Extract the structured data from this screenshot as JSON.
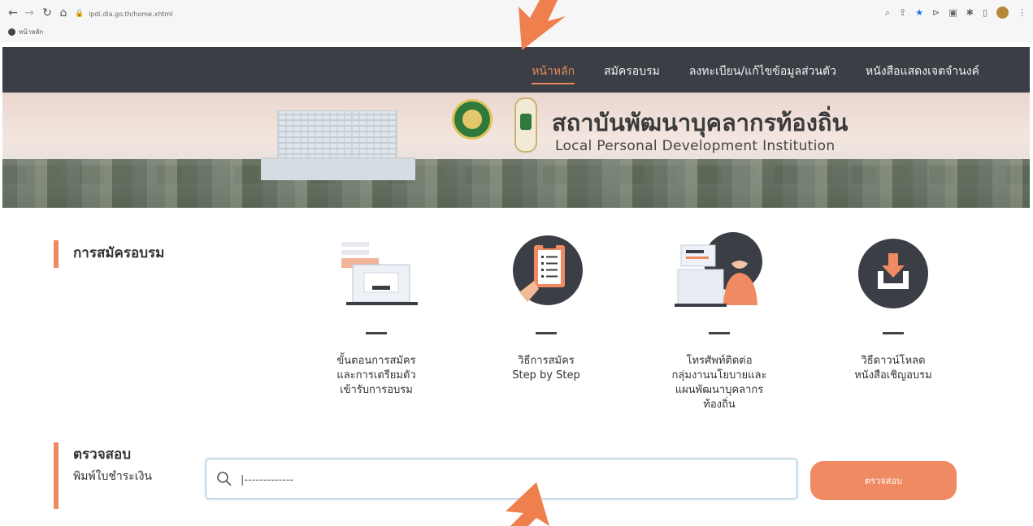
{
  "browser": {
    "url": "lpdi.dla.go.th/home.xhtml",
    "bookmark_label": "หน้าหลัก"
  },
  "nav": {
    "items": [
      {
        "label": "หน้าหลัก",
        "active": true
      },
      {
        "label": "สมัครอบรม",
        "active": false
      },
      {
        "label": "ลงทะเบียน/แก้ไขข้อมูลส่วนตัว",
        "active": false
      },
      {
        "label": "หนังสือแสดงเจตจำนงค์",
        "active": false
      }
    ]
  },
  "banner": {
    "org_name_th": "สถาบันพัฒนาบุคลากรท้องถิ่น",
    "org_name_en": "Local Personal Development Institution"
  },
  "registration": {
    "title": "การสมัครอบรม",
    "cards": [
      {
        "icon": "laptop-form-icon",
        "label": "ขั้นตอนการสมัคร\nและการเตรียมตัว\nเข้ารับการอบรม"
      },
      {
        "icon": "clipboard-checklist-icon",
        "label": "วิธีการสมัคร\nStep by Step"
      },
      {
        "icon": "call-center-icon",
        "label": "โทรศัพท์ติดต่อ\nกลุ่มงานนโยบายและ\nแผนพัฒนาบุคลากร\nท้องถิ่น"
      },
      {
        "icon": "download-icon",
        "label": "วิธีดาวน์โหลด\nหนังสือเชิญอบรม"
      }
    ]
  },
  "check": {
    "title": "ตรวจสอบ",
    "subtitle": "พิมพ์ใบชำระเงิน",
    "input_value": "|-------------",
    "button_label": "ตรวจสอบ"
  },
  "colors": {
    "accent": "#ee8a62",
    "navbar": "#3b3e45",
    "annotation_arrow": "#ef7f4c"
  }
}
